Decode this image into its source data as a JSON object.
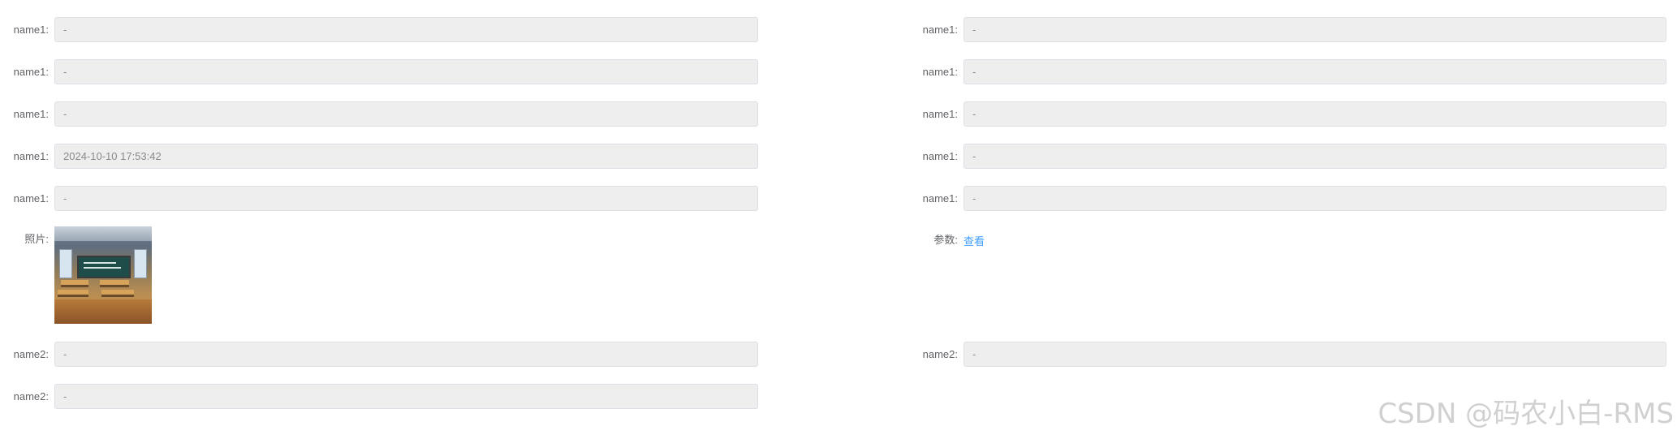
{
  "left": {
    "rows": [
      {
        "label": "name1:",
        "value": "-"
      },
      {
        "label": "name1:",
        "value": "-"
      },
      {
        "label": "name1:",
        "value": "-"
      },
      {
        "label": "name1:",
        "value": "2024-10-10 17:53:42"
      },
      {
        "label": "name1:",
        "value": "-"
      }
    ],
    "photo_label": "照片:",
    "rows2": [
      {
        "label": "name2:",
        "value": "-"
      },
      {
        "label": "name2:",
        "value": "-"
      }
    ]
  },
  "right": {
    "rows": [
      {
        "label": "name1:",
        "value": "-"
      },
      {
        "label": "name1:",
        "value": "-"
      },
      {
        "label": "name1:",
        "value": "-"
      },
      {
        "label": "name1:",
        "value": "-"
      },
      {
        "label": "name1:",
        "value": "-"
      }
    ],
    "param_label": "参数:",
    "param_link": "查看",
    "rows2": [
      {
        "label": "name2:",
        "value": "-"
      }
    ]
  },
  "watermark": "CSDN @码农小白-RMS",
  "colors": {
    "field_bg": "#eeeeee",
    "field_border": "#dcdfe6",
    "label": "#606266",
    "link": "#409eff"
  }
}
